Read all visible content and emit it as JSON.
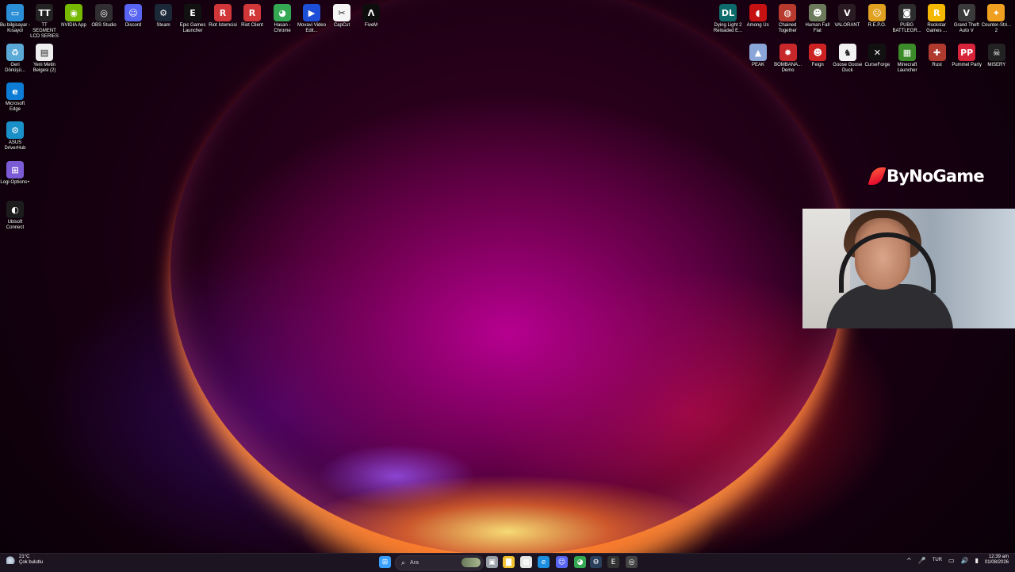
{
  "desktop": {
    "left_row": [
      {
        "label": "Bu bilgisayar - Kısayol",
        "color": "#2a8fd6",
        "glyph": "▭",
        "icon": "computer-icon"
      },
      {
        "label": "TT SEGMENT LCD SERIES",
        "color": "#222222",
        "glyph": "TT",
        "icon": "tt-icon"
      },
      {
        "label": "NVIDIA App",
        "color": "#76b900",
        "glyph": "◉",
        "icon": "nvidia-icon"
      },
      {
        "label": "OBS Studio",
        "color": "#302e31",
        "glyph": "◎",
        "icon": "obs-icon"
      },
      {
        "label": "Discord",
        "color": "#5865f2",
        "glyph": "☺",
        "icon": "discord-icon"
      },
      {
        "label": "Steam",
        "color": "#1b2838",
        "glyph": "⚙",
        "icon": "steam-icon"
      },
      {
        "label": "Epic Games Launcher",
        "color": "#111111",
        "glyph": "E",
        "icon": "epic-games-icon"
      },
      {
        "label": "Riot İstemcisi",
        "color": "#d13639",
        "glyph": "R",
        "icon": "riot-icon"
      },
      {
        "label": "Riot Client",
        "color": "#d13639",
        "glyph": "R",
        "icon": "riot-client-icon"
      },
      {
        "label": "Hasan - Chrome",
        "color": "#34a853",
        "glyph": "◕",
        "icon": "chrome-icon"
      },
      {
        "label": "Movavi Video Edit...",
        "color": "#1d4ed8",
        "glyph": "▶",
        "icon": "movavi-icon"
      },
      {
        "label": "CapCut",
        "color": "#f5f5f5",
        "glyph": "✂",
        "icon": "capcut-icon"
      },
      {
        "label": "FiveM",
        "color": "#0d0d0d",
        "glyph": "Λ",
        "icon": "fivem-icon"
      }
    ],
    "left_col": [
      {
        "label": "Geri Dönüşü...",
        "color": "#5aa9d6",
        "glyph": "♻",
        "icon": "recycle-bin-icon"
      },
      {
        "label": "Yeni Metin Belgesi (2)",
        "color": "#eeeeee",
        "glyph": "▤",
        "icon": "text-document-icon"
      },
      {
        "label": "Microsoft Edge",
        "color": "#0c7cd5",
        "glyph": "e",
        "icon": "edge-icon"
      },
      {
        "label": "ASUS DriverHub",
        "color": "#1a90c8",
        "glyph": "⚙",
        "icon": "asus-driverhub-icon"
      },
      {
        "label": "Logi Options+",
        "color": "#7b5cd6",
        "glyph": "⊞",
        "icon": "logi-options-icon"
      },
      {
        "label": "Ubisoft Connect",
        "color": "#1c1c1c",
        "glyph": "◐",
        "icon": "ubisoft-icon"
      }
    ],
    "right_row1": [
      {
        "label": "Dying Light 2 Reloaded E...",
        "color": "#0e6b6b",
        "glyph": "DL",
        "icon": "dying-light-icon"
      },
      {
        "label": "Among Us",
        "color": "#c51111",
        "glyph": "◖",
        "icon": "among-us-icon"
      },
      {
        "label": "Chained Together",
        "color": "#b83a2e",
        "glyph": "◍",
        "icon": "chained-together-icon"
      },
      {
        "label": "Human Fall Flat",
        "color": "#6b7a5a",
        "glyph": "☻",
        "icon": "human-fall-flat-icon"
      },
      {
        "label": "VALORANT",
        "color": "#2a1a22",
        "glyph": "V",
        "icon": "valorant-icon"
      },
      {
        "label": "R.E.P.O.",
        "color": "#e0a020",
        "glyph": "☹",
        "icon": "repo-icon"
      },
      {
        "label": "PUBG BATTLEGR...",
        "color": "#2d2d2d",
        "glyph": "◙",
        "icon": "pubg-icon"
      },
      {
        "label": "Rockstar Games ...",
        "color": "#f5b800",
        "glyph": "R",
        "icon": "rockstar-icon"
      },
      {
        "label": "Grand Theft Auto V",
        "color": "#3a3a3a",
        "glyph": "V",
        "icon": "gta-icon"
      },
      {
        "label": "Counter-Stri... 2",
        "color": "#f0a020",
        "glyph": "✦",
        "icon": "counter-strike-icon"
      }
    ],
    "right_row2": [
      {
        "label": "PEAK",
        "color": "#8aa6d8",
        "glyph": "▲",
        "icon": "peak-icon"
      },
      {
        "label": "BOMBANA... Demo",
        "color": "#c8282a",
        "glyph": "✹",
        "icon": "bombana-icon"
      },
      {
        "label": "Feign",
        "color": "#cc2222",
        "glyph": "☻",
        "icon": "feign-icon"
      },
      {
        "label": "Goose Goose Duck",
        "color": "#f2f2f2",
        "glyph": "♞",
        "icon": "goose-goose-duck-icon"
      },
      {
        "label": "CurseForge",
        "color": "#111111",
        "glyph": "✕",
        "icon": "curseforge-icon"
      },
      {
        "label": "Minecraft Launcher",
        "color": "#3c8b2a",
        "glyph": "▦",
        "icon": "minecraft-icon"
      },
      {
        "label": "Rust",
        "color": "#b03a2e",
        "glyph": "✚",
        "icon": "rust-icon"
      },
      {
        "label": "Pummel Party",
        "color": "#d8243a",
        "glyph": "PP",
        "icon": "pummel-party-icon"
      },
      {
        "label": "MISERY",
        "color": "#222222",
        "glyph": "☠",
        "icon": "misery-icon"
      }
    ]
  },
  "overlay": {
    "brand": "ByNoGame"
  },
  "taskbar": {
    "weather": {
      "temp": "21°C",
      "condition": "Çok bulutlu"
    },
    "search_placeholder": "Ara",
    "apps": [
      {
        "name": "start-button",
        "glyph": "⊞",
        "color": "#3aa0ff"
      },
      {
        "name": "task-view-icon",
        "glyph": "▣",
        "color": "#9aa0a8"
      },
      {
        "name": "file-explorer-icon",
        "glyph": "▇",
        "color": "#f2c230"
      },
      {
        "name": "store-icon",
        "glyph": "▦",
        "color": "#e6e6e6"
      },
      {
        "name": "edge-taskbar-icon",
        "glyph": "e",
        "color": "#1c8ee0"
      },
      {
        "name": "discord-taskbar-icon",
        "glyph": "☺",
        "color": "#5865f2"
      },
      {
        "name": "chrome-taskbar-icon",
        "glyph": "◕",
        "color": "#34a853"
      },
      {
        "name": "steam-taskbar-icon",
        "glyph": "⚙",
        "color": "#2a3f5a"
      },
      {
        "name": "epic-taskbar-icon",
        "glyph": "E",
        "color": "#333333"
      },
      {
        "name": "obs-taskbar-icon",
        "glyph": "◎",
        "color": "#444444"
      }
    ],
    "tray": {
      "chevron": "^",
      "mic": "🎤",
      "language": "TUR",
      "network": "▭",
      "volume": "🔊",
      "battery": "▮",
      "time": "12:39 am",
      "date": "01/08/2026"
    }
  }
}
